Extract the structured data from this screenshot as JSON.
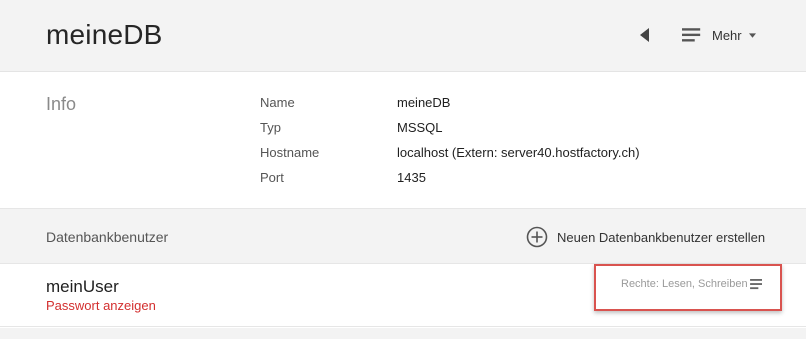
{
  "header": {
    "title": "meineDB",
    "back_icon": "back-triangle-icon",
    "more_label": "Mehr"
  },
  "info": {
    "heading": "Info",
    "rows": [
      {
        "label": "Name",
        "value": "meineDB"
      },
      {
        "label": "Typ",
        "value": "MSSQL"
      },
      {
        "label": "Hostname",
        "value": "localhost (Extern: server40.hostfactory.ch)"
      },
      {
        "label": "Port",
        "value": "1435"
      }
    ]
  },
  "users": {
    "title": "Datenbankbenutzer",
    "new_user_label": "Neuen Datenbankbenutzer erstellen",
    "items": [
      {
        "name": "meinUser",
        "password_link": "Passwort anzeigen",
        "rights": "Rechte: Lesen, Schreiben"
      }
    ]
  },
  "colors": {
    "header_bg": "#f3f3f3",
    "link_red": "#d32f2f",
    "highlight_border": "#d9534f"
  }
}
